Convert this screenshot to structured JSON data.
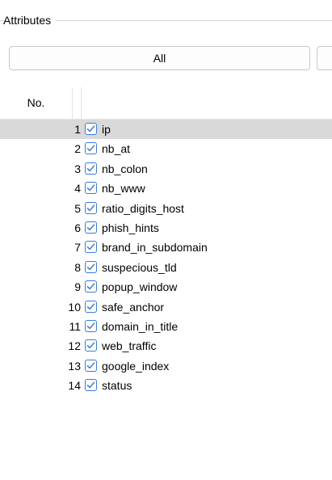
{
  "group": {
    "legend": "Attributes"
  },
  "buttons": {
    "all_label": "All",
    "none_label": ""
  },
  "table": {
    "header_no": "No.",
    "selected_row": 1,
    "rows": [
      {
        "num": "1",
        "name": "ip",
        "checked": true
      },
      {
        "num": "2",
        "name": "nb_at",
        "checked": true
      },
      {
        "num": "3",
        "name": "nb_colon",
        "checked": true
      },
      {
        "num": "4",
        "name": "nb_www",
        "checked": true
      },
      {
        "num": "5",
        "name": "ratio_digits_host",
        "checked": true
      },
      {
        "num": "6",
        "name": "phish_hints",
        "checked": true
      },
      {
        "num": "7",
        "name": "brand_in_subdomain",
        "checked": true
      },
      {
        "num": "8",
        "name": "suspecious_tld",
        "checked": true
      },
      {
        "num": "9",
        "name": "popup_window",
        "checked": true
      },
      {
        "num": "10",
        "name": "safe_anchor",
        "checked": true
      },
      {
        "num": "11",
        "name": "domain_in_title",
        "checked": true
      },
      {
        "num": "12",
        "name": "web_traffic",
        "checked": true
      },
      {
        "num": "13",
        "name": "google_index",
        "checked": true
      },
      {
        "num": "14",
        "name": "status",
        "checked": true
      }
    ]
  },
  "colors": {
    "checkbox_border": "#3a7bd5",
    "checkmark": "#3a7bd5",
    "selected_row": "#d9d9d9"
  }
}
